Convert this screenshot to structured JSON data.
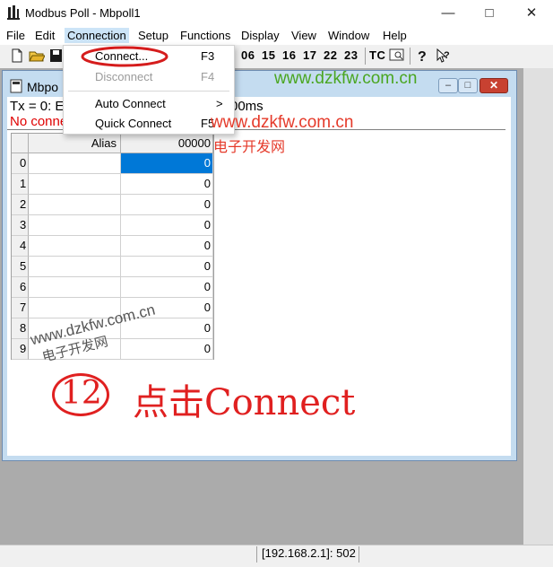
{
  "window": {
    "title": "Modbus Poll - Mbpoll1"
  },
  "menubar": [
    "File",
    "Edit",
    "Connection",
    "Setup",
    "Functions",
    "Display",
    "View",
    "Window",
    "Help"
  ],
  "toolbar": {
    "function_codes": [
      "06",
      "15",
      "16",
      "17",
      "22",
      "23"
    ],
    "tc_label": "TC"
  },
  "connection_menu": {
    "items": [
      {
        "label": "Connect...",
        "shortcut": "F3",
        "enabled": true
      },
      {
        "label": "Disconnect",
        "shortcut": "F4",
        "enabled": false
      },
      {
        "label": "Auto Connect",
        "submenu_arrow": ">"
      },
      {
        "label": "Quick Connect",
        "shortcut": "F5"
      }
    ]
  },
  "child": {
    "title": "Mbpo",
    "status_line1_left": "Tx = 0: E",
    "status_line1_right": "00ms",
    "status_line2": "No conne",
    "table": {
      "headers": {
        "alias": "Alias",
        "value": "00000"
      },
      "rows": [
        {
          "index": "0",
          "value": "0"
        },
        {
          "index": "1",
          "value": "0"
        },
        {
          "index": "2",
          "value": "0"
        },
        {
          "index": "3",
          "value": "0"
        },
        {
          "index": "4",
          "value": "0"
        },
        {
          "index": "5",
          "value": "0"
        },
        {
          "index": "6",
          "value": "0"
        },
        {
          "index": "7",
          "value": "0"
        },
        {
          "index": "8",
          "value": "0"
        },
        {
          "index": "9",
          "value": "0"
        }
      ]
    }
  },
  "watermarks": {
    "green": "www.dzkfw.com.cn",
    "red_site": "www.dzkfw.com.cn",
    "red_cn": "电子开发网"
  },
  "annotation": {
    "number": "12",
    "text": "点击Connect"
  },
  "statusbar": {
    "address": "[192.168.2.1]: 502"
  },
  "colors": {
    "accent": "#e02020",
    "selection": "#0078d7",
    "menu_highlight": "#cce4f7",
    "watermark_green": "#4aa620"
  }
}
